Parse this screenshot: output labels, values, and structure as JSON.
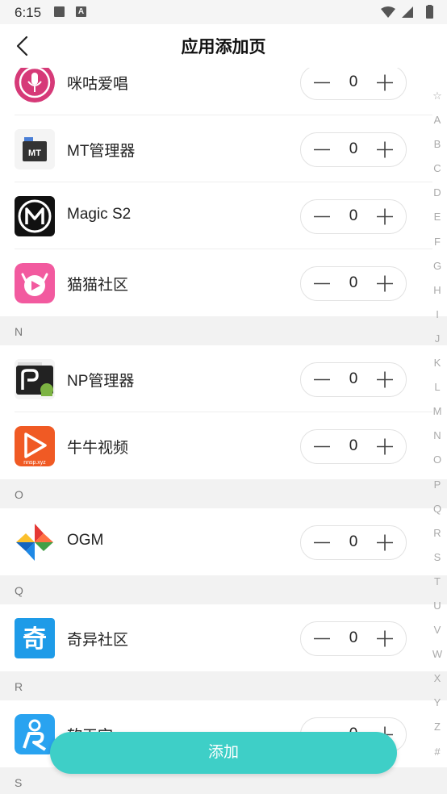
{
  "status_bar": {
    "time": "6:15"
  },
  "header": {
    "title": "应用添加页"
  },
  "sections": [
    {
      "letter": "",
      "apps": [
        {
          "name": "咪咕爱唱",
          "count": "0",
          "icon": "migu-mic-icon"
        },
        {
          "name": "MT管理器",
          "count": "0",
          "icon": "mt-manager-icon"
        },
        {
          "name": "Magic S2",
          "count": "0",
          "icon": "magic-s2-icon"
        },
        {
          "name": "猫猫社区",
          "count": "0",
          "icon": "cat-community-icon"
        }
      ]
    },
    {
      "letter": "N",
      "apps": [
        {
          "name": "NP管理器",
          "count": "0",
          "icon": "np-manager-icon"
        },
        {
          "name": "牛牛视频",
          "count": "0",
          "icon": "niuniu-video-icon"
        }
      ]
    },
    {
      "letter": "O",
      "apps": [
        {
          "name": "OGM",
          "count": "0",
          "icon": "ogm-pinwheel-icon"
        }
      ]
    },
    {
      "letter": "Q",
      "apps": [
        {
          "name": "奇异社区",
          "count": "0",
          "icon": "qiyi-community-icon"
        }
      ]
    },
    {
      "letter": "R",
      "apps": [
        {
          "name": "软天空",
          "count": "0",
          "icon": "ruan-tiankong-icon"
        }
      ]
    },
    {
      "letter": "S",
      "apps": []
    }
  ],
  "icon_text": {
    "niuniu": "nnsp.xyz",
    "mt": "MT"
  },
  "index_letters": [
    "☆",
    "A",
    "B",
    "C",
    "D",
    "E",
    "F",
    "G",
    "H",
    "I",
    "J",
    "K",
    "L",
    "M",
    "N",
    "O",
    "P",
    "Q",
    "R",
    "S",
    "T",
    "U",
    "V",
    "W",
    "X",
    "Y",
    "Z",
    "#"
  ],
  "footer": {
    "add_label": "添加"
  },
  "colors": {
    "accent": "#3ecfc7",
    "section_bg": "#f2f2f2"
  }
}
